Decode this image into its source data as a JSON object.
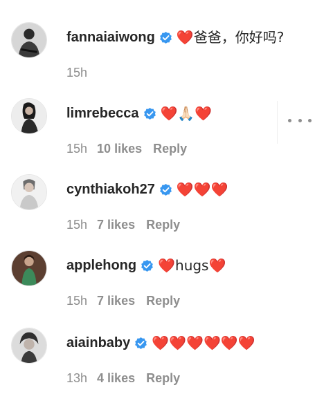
{
  "comments": [
    {
      "username": "fannaiaiwong",
      "text": "❤️爸爸，你好吗?",
      "time": "15h",
      "likes": "",
      "reply": "",
      "avatar_colors": {
        "bg": "#d9d9d9",
        "fg": "#2a2a2a"
      }
    },
    {
      "username": "limrebecca",
      "text": "❤️🙏🏻❤️",
      "time": "15h",
      "likes": "10 likes",
      "reply": "Reply",
      "avatar_colors": {
        "bg": "#e9e9e9",
        "fg": "#1b1b1b"
      }
    },
    {
      "username": "cynthiakoh27",
      "text": "❤️❤️❤️",
      "time": "15h",
      "likes": "7 likes",
      "reply": "Reply",
      "avatar_colors": {
        "bg": "#ececec",
        "fg": "#8b8b8b"
      }
    },
    {
      "username": "applehong",
      "text": "❤️hugs❤️",
      "time": "15h",
      "likes": "7 likes",
      "reply": "Reply",
      "avatar_colors": {
        "bg": "#5a3b2e",
        "fg": "#3c8a5a"
      }
    },
    {
      "username": "aiainbaby",
      "text": "❤️❤️❤️❤️❤️❤️",
      "time": "13h",
      "likes": "4 likes",
      "reply": "Reply",
      "avatar_colors": {
        "bg": "#d7d7d7",
        "fg": "#333333"
      }
    }
  ],
  "colors": {
    "username": "#262626",
    "meta": "#8e8e8e",
    "verified_badge": "#3897f0",
    "heart": "#ed4956"
  },
  "icons": {
    "verified": "verified-badge-icon",
    "more": "more-options-icon"
  }
}
